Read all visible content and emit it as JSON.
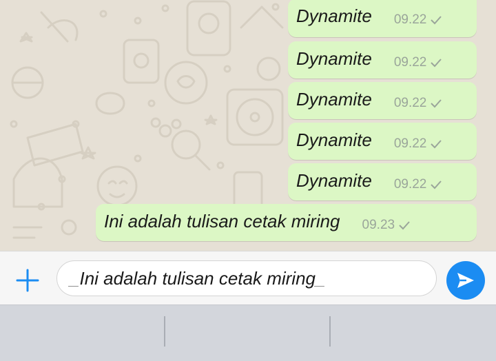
{
  "messages": [
    {
      "text": "Dynamite",
      "time": "09.22"
    },
    {
      "text": "Dynamite",
      "time": "09.22"
    },
    {
      "text": "Dynamite",
      "time": "09.22"
    },
    {
      "text": "Dynamite",
      "time": "09.22"
    },
    {
      "text": "Dynamite",
      "time": "09.22"
    },
    {
      "text": "Ini adalah tulisan cetak miring",
      "time": "09.23"
    }
  ],
  "composer": {
    "mark_open": "_",
    "text": "Ini adalah tulisan cetak miring",
    "mark_close": "_"
  },
  "icons": {
    "attach": "plus-icon",
    "send": "send-icon",
    "status": "check-icon"
  },
  "colors": {
    "outgoing_bubble": "#dcf7c5",
    "accent": "#1b8cf2",
    "wallpaper": "#e6e0d5"
  }
}
